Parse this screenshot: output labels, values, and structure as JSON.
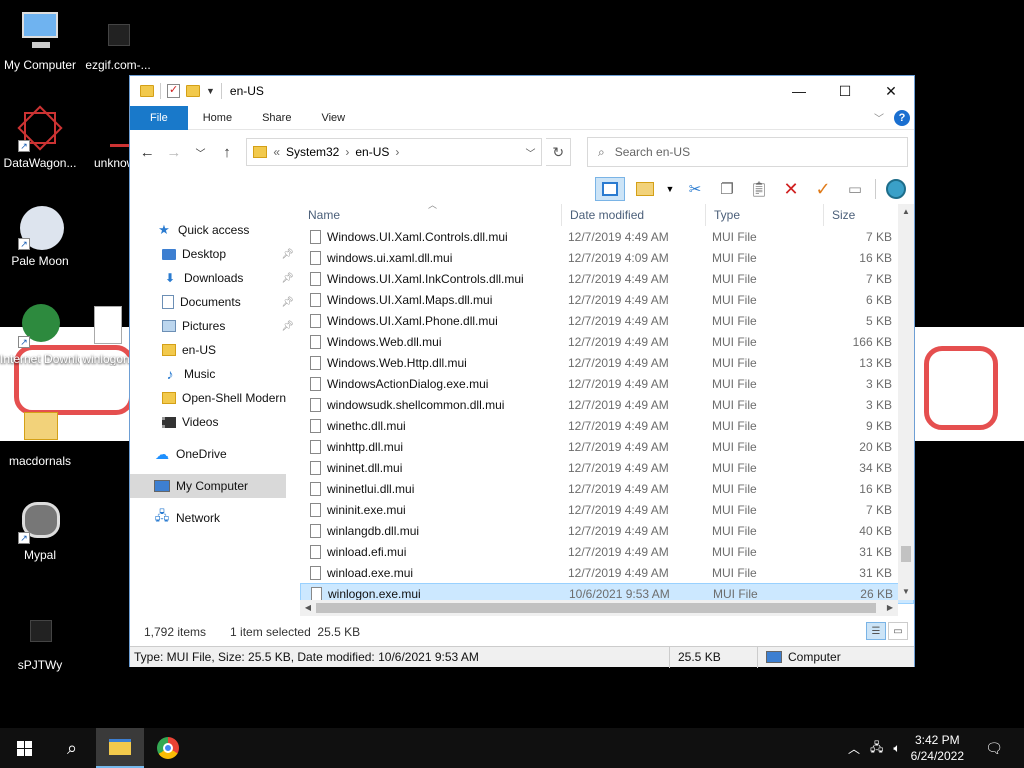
{
  "desktop": {
    "icons": [
      {
        "label": "My Computer"
      },
      {
        "label": "ezgif.com-..."
      },
      {
        "label": "DataWagon..."
      },
      {
        "label": "unknown"
      },
      {
        "label": "Pale Moon"
      },
      {
        "label": "Internet Downlo..."
      },
      {
        "label": "winlogon"
      },
      {
        "label": "macdornals"
      },
      {
        "label": "Mypal"
      },
      {
        "label": "sPJTWy"
      }
    ]
  },
  "window": {
    "title": "en-US",
    "ribbon_tabs": [
      "File",
      "Home",
      "Share",
      "View"
    ],
    "address": {
      "prefix": "«",
      "crumbs": [
        "System32",
        "en-US"
      ]
    },
    "search_placeholder": "Search en-US",
    "nav": [
      {
        "label": "Quick access",
        "icon": "star-icon"
      },
      {
        "label": "Desktop",
        "icon": "desktop-folder-icon",
        "pinned": true
      },
      {
        "label": "Downloads",
        "icon": "downloads-icon",
        "pinned": true
      },
      {
        "label": "Documents",
        "icon": "documents-icon",
        "pinned": true
      },
      {
        "label": "Pictures",
        "icon": "pictures-icon",
        "pinned": true
      },
      {
        "label": "en-US",
        "icon": "folder-icon"
      },
      {
        "label": "Music",
        "icon": "music-icon"
      },
      {
        "label": "Open-Shell Modern",
        "icon": "folder-icon"
      },
      {
        "label": "Videos",
        "icon": "videos-icon"
      },
      {
        "label": "OneDrive",
        "icon": "onedrive-icon"
      },
      {
        "label": "My Computer",
        "icon": "computer-icon"
      },
      {
        "label": "Network",
        "icon": "network-icon"
      }
    ],
    "columns": [
      "Name",
      "Date modified",
      "Type",
      "Size"
    ],
    "files": [
      {
        "name": "Windows.UI.Xaml.Controls.dll.mui",
        "date": "12/7/2019 4:49 AM",
        "type": "MUI File",
        "size": "7 KB"
      },
      {
        "name": "windows.ui.xaml.dll.mui",
        "date": "12/7/2019 4:09 AM",
        "type": "MUI File",
        "size": "16 KB"
      },
      {
        "name": "Windows.UI.Xaml.InkControls.dll.mui",
        "date": "12/7/2019 4:49 AM",
        "type": "MUI File",
        "size": "7 KB"
      },
      {
        "name": "Windows.UI.Xaml.Maps.dll.mui",
        "date": "12/7/2019 4:49 AM",
        "type": "MUI File",
        "size": "6 KB"
      },
      {
        "name": "Windows.UI.Xaml.Phone.dll.mui",
        "date": "12/7/2019 4:49 AM",
        "type": "MUI File",
        "size": "5 KB"
      },
      {
        "name": "Windows.Web.dll.mui",
        "date": "12/7/2019 4:49 AM",
        "type": "MUI File",
        "size": "166 KB"
      },
      {
        "name": "Windows.Web.Http.dll.mui",
        "date": "12/7/2019 4:49 AM",
        "type": "MUI File",
        "size": "13 KB"
      },
      {
        "name": "WindowsActionDialog.exe.mui",
        "date": "12/7/2019 4:49 AM",
        "type": "MUI File",
        "size": "3 KB"
      },
      {
        "name": "windowsudk.shellcommon.dll.mui",
        "date": "12/7/2019 4:49 AM",
        "type": "MUI File",
        "size": "3 KB"
      },
      {
        "name": "winethc.dll.mui",
        "date": "12/7/2019 4:49 AM",
        "type": "MUI File",
        "size": "9 KB"
      },
      {
        "name": "winhttp.dll.mui",
        "date": "12/7/2019 4:49 AM",
        "type": "MUI File",
        "size": "20 KB"
      },
      {
        "name": "wininet.dll.mui",
        "date": "12/7/2019 4:49 AM",
        "type": "MUI File",
        "size": "34 KB"
      },
      {
        "name": "wininetlui.dll.mui",
        "date": "12/7/2019 4:49 AM",
        "type": "MUI File",
        "size": "16 KB"
      },
      {
        "name": "wininit.exe.mui",
        "date": "12/7/2019 4:49 AM",
        "type": "MUI File",
        "size": "7 KB"
      },
      {
        "name": "winlangdb.dll.mui",
        "date": "12/7/2019 4:49 AM",
        "type": "MUI File",
        "size": "40 KB"
      },
      {
        "name": "winload.efi.mui",
        "date": "12/7/2019 4:49 AM",
        "type": "MUI File",
        "size": "31 KB"
      },
      {
        "name": "winload.exe.mui",
        "date": "12/7/2019 4:49 AM",
        "type": "MUI File",
        "size": "31 KB"
      },
      {
        "name": "winlogon.exe.mui",
        "date": "10/6/2021 9:53 AM",
        "type": "MUI File",
        "size": "26 KB",
        "selected": true
      }
    ],
    "status": {
      "count": "1,792 items",
      "selection": "1 item selected  25.5 KB"
    },
    "statusbar": {
      "details": "Type: MUI File, Size: 25.5 KB, Date modified: 10/6/2021 9:53 AM",
      "size": "25.5 KB",
      "location": "Computer"
    }
  },
  "taskbar": {
    "time": "3:42 PM",
    "date": "6/24/2022"
  },
  "colors": {
    "accent": "#1979ca",
    "selection": "#cce8ff"
  }
}
